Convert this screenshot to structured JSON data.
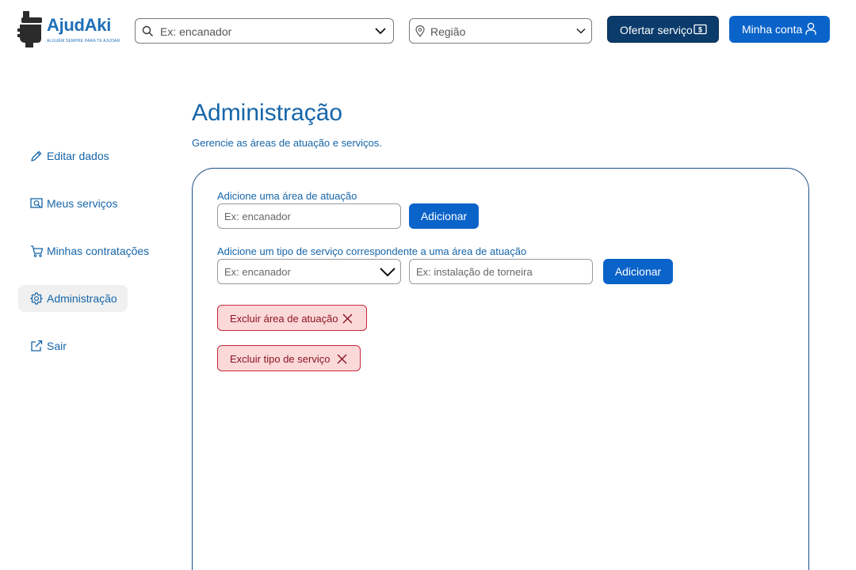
{
  "app": {
    "name": "AjudAki",
    "tagline": "ALGUÉM SEMPRE PARA TE AJUDAR"
  },
  "header": {
    "search": {
      "placeholder": "Ex: encanador",
      "icon": "search-icon"
    },
    "region": {
      "placeholder": "Região",
      "icon": "location-pin-icon"
    },
    "offer_button": {
      "label": "Ofertar serviço",
      "icon": "money-icon"
    },
    "account_button": {
      "label": "Minha conta",
      "icon": "user-icon"
    }
  },
  "sidebar": {
    "items": [
      {
        "label": "Editar dados",
        "icon": "pencil-icon",
        "active": false
      },
      {
        "label": "Meus serviços",
        "icon": "services-icon",
        "active": false
      },
      {
        "label": "Minhas contratações",
        "icon": "cart-icon",
        "active": false
      },
      {
        "label": "Administração",
        "icon": "gear-icon",
        "active": true
      },
      {
        "label": "Sair",
        "icon": "external-link-icon",
        "active": false
      }
    ]
  },
  "main": {
    "title": "Administração",
    "subtitle": "Gerencie as áreas de atuação e serviços.",
    "area_form": {
      "label": "Adicione uma área de atuação",
      "input_placeholder": "Ex: encanador",
      "add_button": "Adicionar"
    },
    "service_form": {
      "label": "Adicione um tipo de serviço correspondente a uma área de atuação",
      "select_placeholder": "Ex: encanador",
      "input_placeholder": "Ex: instalação de torneira",
      "add_button": "Adicionar"
    },
    "delete_area_button": "Excluir área de atuação",
    "delete_service_button": "Excluir tipo de serviço"
  },
  "colors": {
    "primary": "#0a63c9",
    "dark": "#0b3b6b",
    "text": "#1565a8",
    "danger_bg": "#fbd9d9",
    "danger_border": "#c8283a"
  }
}
